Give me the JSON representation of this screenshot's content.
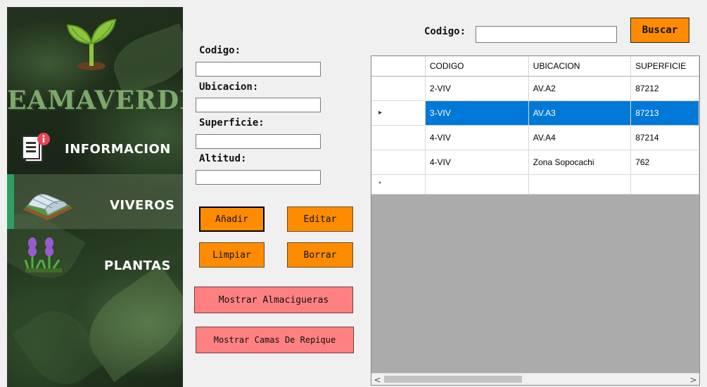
{
  "sidebar": {
    "logo_text": "EAMAVERDE",
    "items": [
      {
        "label": "INFORMACION",
        "icon": "document-info-icon"
      },
      {
        "label": "VIVEROS",
        "icon": "greenhouse-icon",
        "active": true
      },
      {
        "label": "PLANTAS",
        "icon": "lavender-plants-icon"
      }
    ]
  },
  "form": {
    "codigo_label": "Codigo:",
    "ubicacion_label": "Ubicacion:",
    "superficie_label": "Superficie:",
    "altitud_label": "Altitud:",
    "codigo_value": "",
    "ubicacion_value": "",
    "superficie_value": "",
    "altitud_value": ""
  },
  "buttons": {
    "anadir": "Añadir",
    "editar": "Editar",
    "limpiar": "Limpiar",
    "borrar": "Borrar",
    "mostrar_almacigueras": "Mostrar Almacigueras",
    "mostrar_camas": "Mostrar Camas De Repique"
  },
  "search": {
    "label": "Codigo:",
    "value": "",
    "button": "Buscar"
  },
  "grid": {
    "columns": [
      "CODIGO",
      "UBICACION",
      "SUPERFICIE"
    ],
    "rows": [
      [
        "2-VIV",
        "AV.A2",
        "87212"
      ],
      [
        "3-VIV",
        "AV.A3",
        "87213"
      ],
      [
        "4-VIV",
        "AV.A4",
        "87214"
      ],
      [
        "4-VIV",
        "Zona Sopocachi",
        "762"
      ]
    ],
    "selected_row": 1,
    "current_row_marker": "▸",
    "new_row_marker": "*",
    "scroll_left": "<",
    "scroll_right": ">"
  },
  "colors": {
    "accent_orange": "#ff8c00",
    "pink_button": "#ff8080",
    "selection_blue": "#0078d7",
    "sidebar_active_bar": "#2e9e63"
  }
}
